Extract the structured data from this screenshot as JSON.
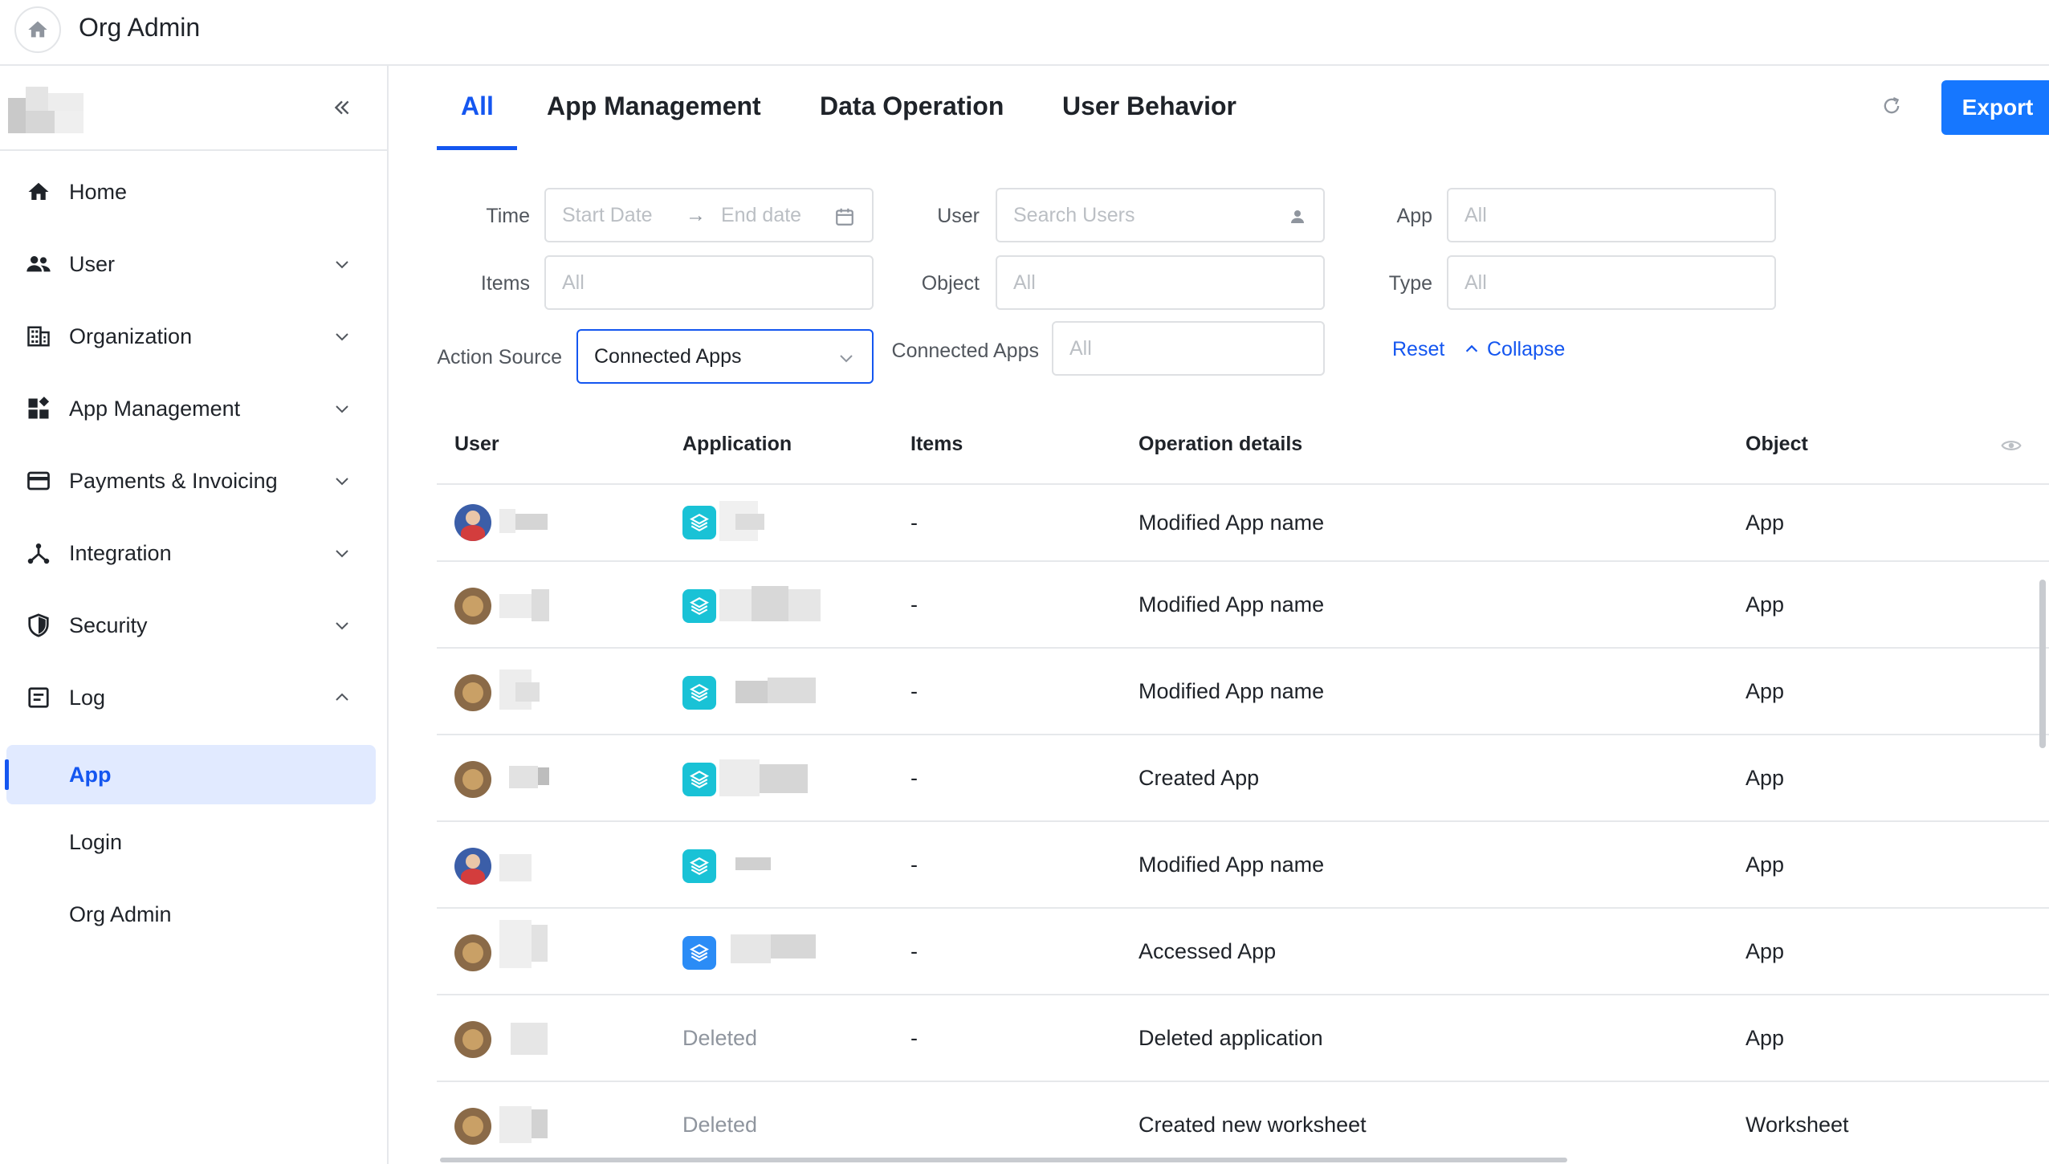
{
  "header": {
    "title": "Org Admin"
  },
  "sidebar": {
    "items": [
      {
        "label": "Home",
        "icon": "home-icon",
        "expandable": false
      },
      {
        "label": "User",
        "icon": "users-icon",
        "expandable": true
      },
      {
        "label": "Organization",
        "icon": "building-icon",
        "expandable": true
      },
      {
        "label": "App Management",
        "icon": "apps-icon",
        "expandable": true
      },
      {
        "label": "Payments & Invoicing",
        "icon": "credit-card-icon",
        "expandable": true
      },
      {
        "label": "Integration",
        "icon": "integration-icon",
        "expandable": true
      },
      {
        "label": "Security",
        "icon": "shield-icon",
        "expandable": true
      },
      {
        "label": "Log",
        "icon": "log-icon",
        "expanded": true
      }
    ],
    "log_children": [
      {
        "label": "App",
        "active": true
      },
      {
        "label": "Login"
      },
      {
        "label": "Org Admin"
      }
    ]
  },
  "tabs": [
    {
      "label": "All",
      "active": true
    },
    {
      "label": "App Management"
    },
    {
      "label": "Data Operation"
    },
    {
      "label": "User Behavior"
    }
  ],
  "toolbar": {
    "export_label": "Export"
  },
  "filters": {
    "time_label": "Time",
    "start_placeholder": "Start Date",
    "end_placeholder": "End date",
    "date_arrow": "→",
    "user_label": "User",
    "user_placeholder": "Search Users",
    "app_label": "App",
    "app_placeholder": "All",
    "items_label": "Items",
    "items_placeholder": "All",
    "object_label": "Object",
    "object_placeholder": "All",
    "type_label": "Type",
    "type_placeholder": "All",
    "action_source_label": "Action Source",
    "action_source_value": "Connected Apps",
    "connected_apps_label": "Connected Apps",
    "connected_apps_placeholder": "All",
    "reset_label": "Reset",
    "collapse_label": "Collapse"
  },
  "table": {
    "columns": [
      "User",
      "Application",
      "Items",
      "Operation details",
      "Object"
    ],
    "rows": [
      {
        "avatar": "blue",
        "app": "icon",
        "items": "-",
        "details": "Modified App name",
        "object": "App"
      },
      {
        "avatar": "brown",
        "app": "icon",
        "items": "-",
        "details": "Modified App name",
        "object": "App"
      },
      {
        "avatar": "brown",
        "app": "icon",
        "items": "-",
        "details": "Modified App name",
        "object": "App"
      },
      {
        "avatar": "brown",
        "app": "icon",
        "items": "-",
        "details": "Created App",
        "object": "App"
      },
      {
        "avatar": "blue",
        "app": "icon",
        "items": "-",
        "details": "Modified App name",
        "object": "App"
      },
      {
        "avatar": "brown",
        "app": "icon-blue",
        "items": "-",
        "details": "Accessed App",
        "object": "App"
      },
      {
        "avatar": "brown",
        "app": "Deleted",
        "items": "-",
        "details": "Deleted application",
        "object": "App"
      },
      {
        "avatar": "brown",
        "app": "Deleted",
        "items": "",
        "details": "Created new worksheet",
        "object": "Worksheet"
      }
    ]
  },
  "colors": {
    "accent": "#1456f0",
    "export_bg": "#1677ff",
    "app_icon_teal": "#19c2d6",
    "app_icon_blue": "#2b8cf6"
  }
}
